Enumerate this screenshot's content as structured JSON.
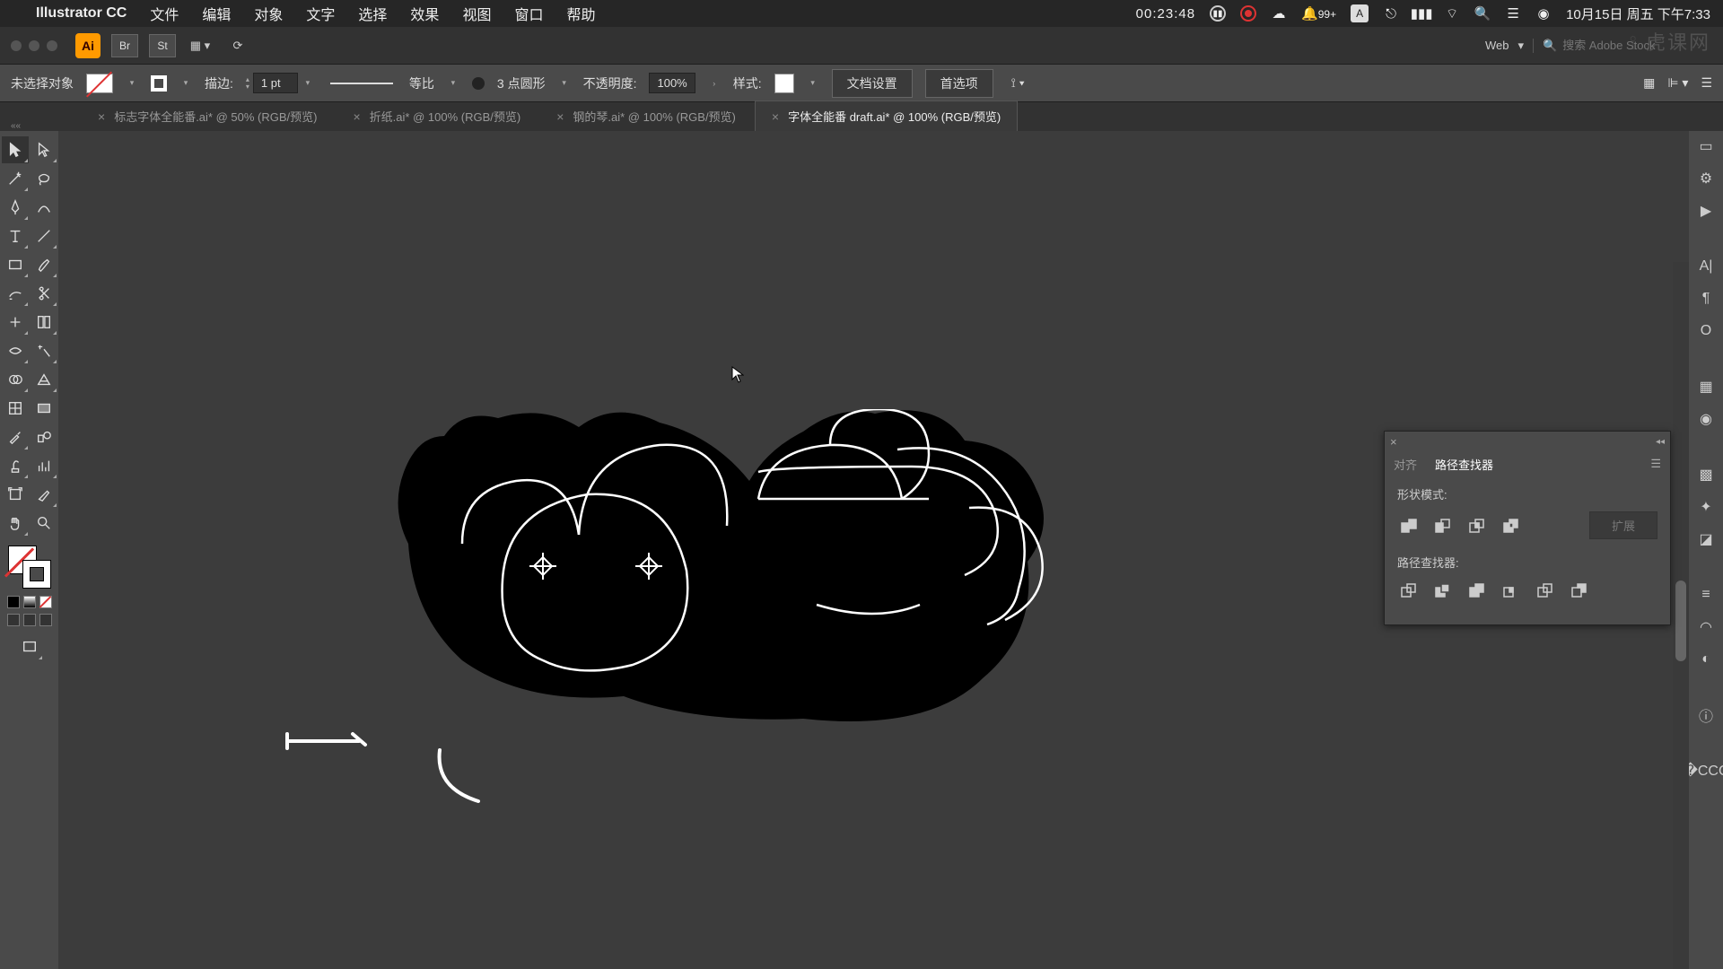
{
  "menubar": {
    "app": "Illustrator CC",
    "items": [
      "文件",
      "编辑",
      "对象",
      "文字",
      "选择",
      "效果",
      "视图",
      "窗口",
      "帮助"
    ],
    "timer": "00:23:48",
    "notif": "99+",
    "date": "10月15日 周五 下午7:33"
  },
  "appbar": {
    "badge": "Ai",
    "docset": "Web",
    "search_placeholder": "搜索 Adobe Stock"
  },
  "ctrlbar": {
    "notarget": "未选择对象",
    "stroke_label": "描边:",
    "stroke_val": "1 pt",
    "profile_label": "等比",
    "brush_label": "3 点圆形",
    "opacity_label": "不透明度:",
    "opacity_val": "100%",
    "style_label": "样式:",
    "btn_docset": "文档设置",
    "btn_prefs": "首选项"
  },
  "tabs": [
    {
      "label": "标志字体全能番.ai* @ 50% (RGB/预览)",
      "active": false
    },
    {
      "label": "折纸.ai* @ 100% (RGB/预览)",
      "active": false
    },
    {
      "label": "钢的琴.ai* @ 100% (RGB/预览)",
      "active": false
    },
    {
      "label": "字体全能番 draft.ai* @ 100% (RGB/预览)",
      "active": true
    }
  ],
  "panel": {
    "tab_align": "对齐",
    "tab_pathfinder": "路径查找器",
    "shape_mode": "形状模式:",
    "pathfinder": "路径查找器:",
    "expand": "扩展"
  },
  "watermark": "虎课网"
}
